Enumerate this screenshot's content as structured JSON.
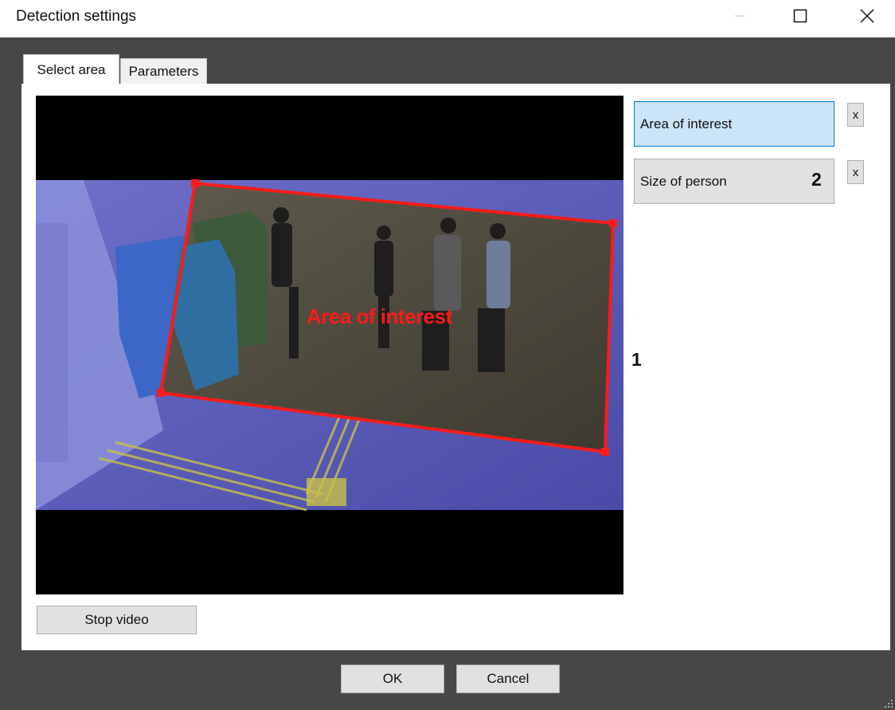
{
  "window": {
    "title": "Detection settings",
    "controls": {
      "minimize": "minimize-icon",
      "maximize": "maximize-icon",
      "close": "close-icon"
    }
  },
  "tabs": [
    {
      "label": "Select area",
      "active": true
    },
    {
      "label": "Parameters",
      "active": false
    }
  ],
  "video": {
    "zone_label": "Area of interest",
    "zone_color": "#ff1a1a"
  },
  "zones": [
    {
      "label": "Area of interest",
      "selected": true,
      "remove_label": "x"
    },
    {
      "label": "Size of person",
      "selected": false,
      "remove_label": "x"
    }
  ],
  "callouts": {
    "one": "1",
    "two": "2"
  },
  "buttons": {
    "stop_video": "Stop video",
    "ok": "OK",
    "cancel": "Cancel"
  },
  "colors": {
    "frame": "#474747",
    "selected_item": "#cce4f7",
    "selected_border": "#0078d7",
    "button": "#e1e1e1"
  }
}
